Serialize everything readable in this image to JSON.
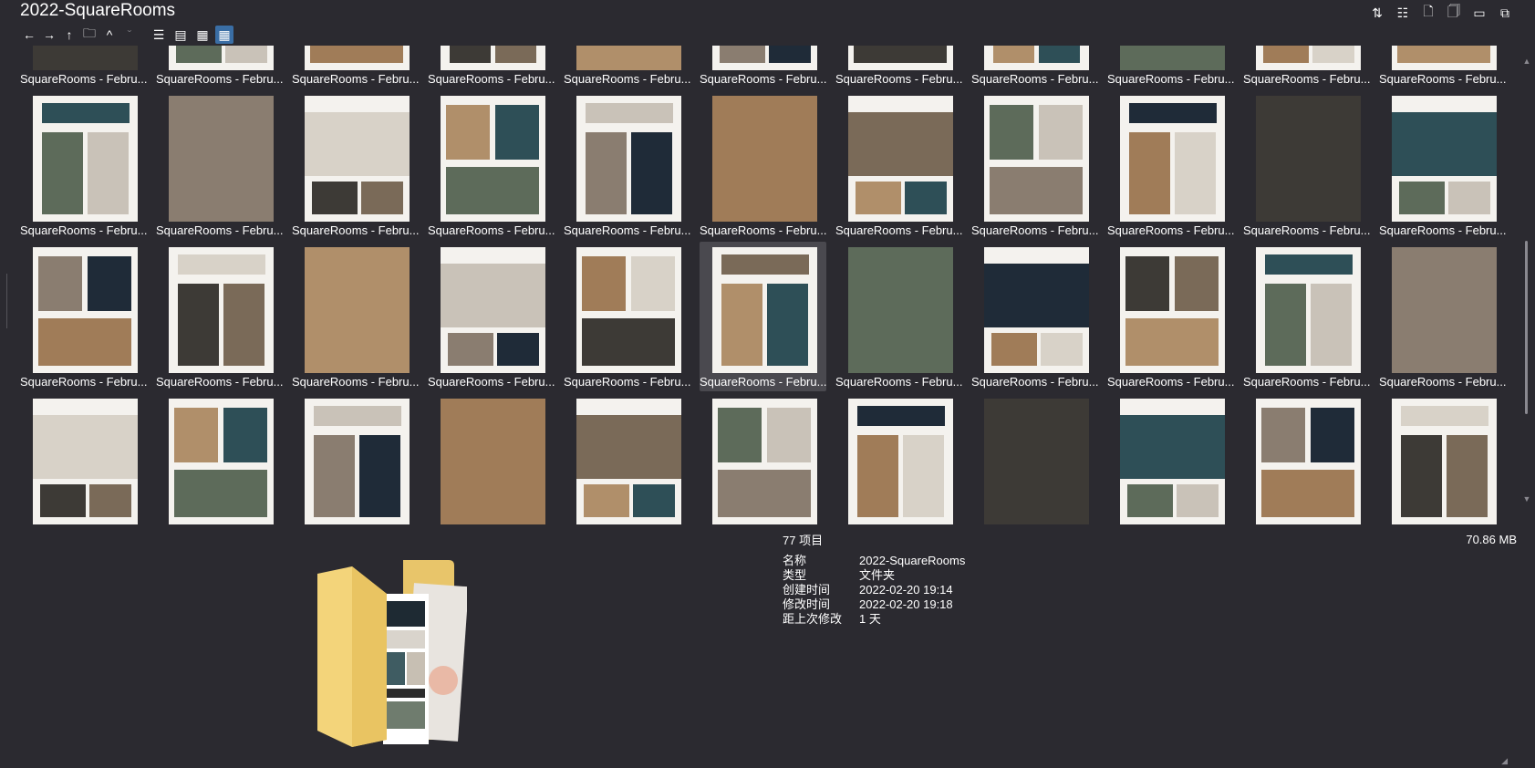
{
  "window": {
    "title": "2022-SquareRooms"
  },
  "toolbar": {
    "nav": [
      {
        "name": "back-icon",
        "glyph": "←"
      },
      {
        "name": "forward-icon",
        "glyph": "→"
      },
      {
        "name": "up-icon",
        "glyph": "↑"
      },
      {
        "name": "folder-open-icon",
        "glyph": "🗀"
      },
      {
        "name": "chevron-up-icon",
        "glyph": "^"
      },
      {
        "name": "chevron-down-icon",
        "glyph": "ˇ"
      }
    ],
    "views": [
      {
        "name": "list-view-icon",
        "glyph": "☰"
      },
      {
        "name": "details-view-icon",
        "glyph": "▤"
      },
      {
        "name": "tiles-view-icon",
        "glyph": "▦"
      },
      {
        "name": "thumbnail-view-icon",
        "glyph": "▦",
        "active": true
      }
    ],
    "right": [
      {
        "name": "sort-icon",
        "glyph": "⇅"
      },
      {
        "name": "group-icon",
        "glyph": "☷"
      },
      {
        "name": "new-file-icon",
        "glyph": "🗋"
      },
      {
        "name": "rename-icon",
        "glyph": "🗍"
      },
      {
        "name": "preview-pane-icon",
        "glyph": "▭"
      },
      {
        "name": "copy-icon",
        "glyph": "⧉"
      }
    ]
  },
  "files": {
    "label": "SquareRooms - Febru...",
    "count": 44,
    "selected_index": 27
  },
  "colors": {
    "background": "#2b2a30",
    "selected": "#4a494f",
    "accent": "#3a6ea5",
    "page": "#f4f2ee"
  },
  "preview": {
    "item_count": "77 项目",
    "total_size": "70.86 MB",
    "properties": [
      {
        "key": "名称",
        "value": "2022-SquareRooms"
      },
      {
        "key": "类型",
        "value": "文件夹"
      },
      {
        "key": "创建时间",
        "value": "2022-02-20  19:14"
      },
      {
        "key": "修改时间",
        "value": "2022-02-20  19:18"
      },
      {
        "key": "距上次修改",
        "value": "1 天"
      }
    ]
  }
}
